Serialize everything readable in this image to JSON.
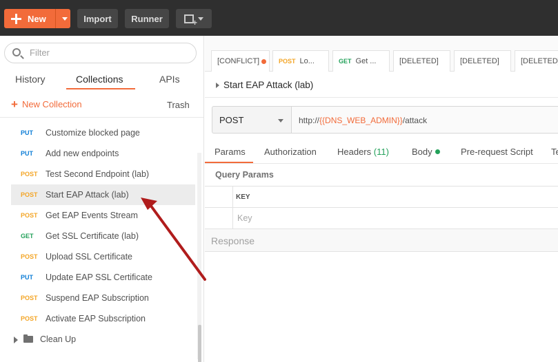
{
  "header": {
    "new_label": "New",
    "import_label": "Import",
    "runner_label": "Runner",
    "icons": {
      "new": "plus-icon",
      "new_window": "new-window-icon"
    }
  },
  "sidebar": {
    "search_placeholder": "Filter",
    "tabs": [
      "History",
      "Collections",
      "APIs"
    ],
    "active_tab": "Collections",
    "new_collection_label": "New Collection",
    "trash_label": "Trash",
    "requests": [
      {
        "method": "PUT",
        "name": "Customize blocked page"
      },
      {
        "method": "PUT",
        "name": "Add new endpoints"
      },
      {
        "method": "POST",
        "name": "Test Second Endpoint (lab)"
      },
      {
        "method": "POST",
        "name": "Start EAP Attack (lab)"
      },
      {
        "method": "POST",
        "name": "Get EAP Events Stream"
      },
      {
        "method": "GET",
        "name": "Get SSL Certificate (lab)"
      },
      {
        "method": "POST",
        "name": "Upload SSL Certificate"
      },
      {
        "method": "PUT",
        "name": "Update EAP SSL Certificate"
      },
      {
        "method": "POST",
        "name": "Suspend EAP Subscription"
      },
      {
        "method": "POST",
        "name": "Activate EAP Subscription"
      }
    ],
    "active_request_index": 3,
    "folder": {
      "name": "Clean Up"
    }
  },
  "request_tabs": [
    {
      "method": "",
      "label": "[CONFLICT]",
      "has_dot": true
    },
    {
      "method": "POST",
      "label": "Lo..."
    },
    {
      "method": "GET",
      "label": "Get ..."
    },
    {
      "method": "",
      "label": "[DELETED]"
    },
    {
      "method": "",
      "label": "[DELETED]"
    },
    {
      "method": "",
      "label": "[DELETED]"
    }
  ],
  "request": {
    "title": "Start EAP Attack (lab)",
    "method": "POST",
    "url_prefix": "http://",
    "url_variable": "{{DNS_WEB_ADMIN}}",
    "url_suffix": "/attack"
  },
  "sub_tabs": {
    "params": "Params",
    "authorization": "Authorization",
    "headers": "Headers",
    "headers_count": "(11)",
    "body": "Body",
    "pre_request": "Pre-request Script",
    "tests_partial": "Te"
  },
  "query_params": {
    "label": "Query Params",
    "key_header": "KEY",
    "key_placeholder": "Key"
  },
  "response": {
    "label": "Response"
  },
  "colors": {
    "accent": "#f26b3a",
    "put": "#0d7dd6",
    "post": "#f3a526",
    "get": "#23a15a",
    "annotation_arrow": "#b01c1c"
  }
}
